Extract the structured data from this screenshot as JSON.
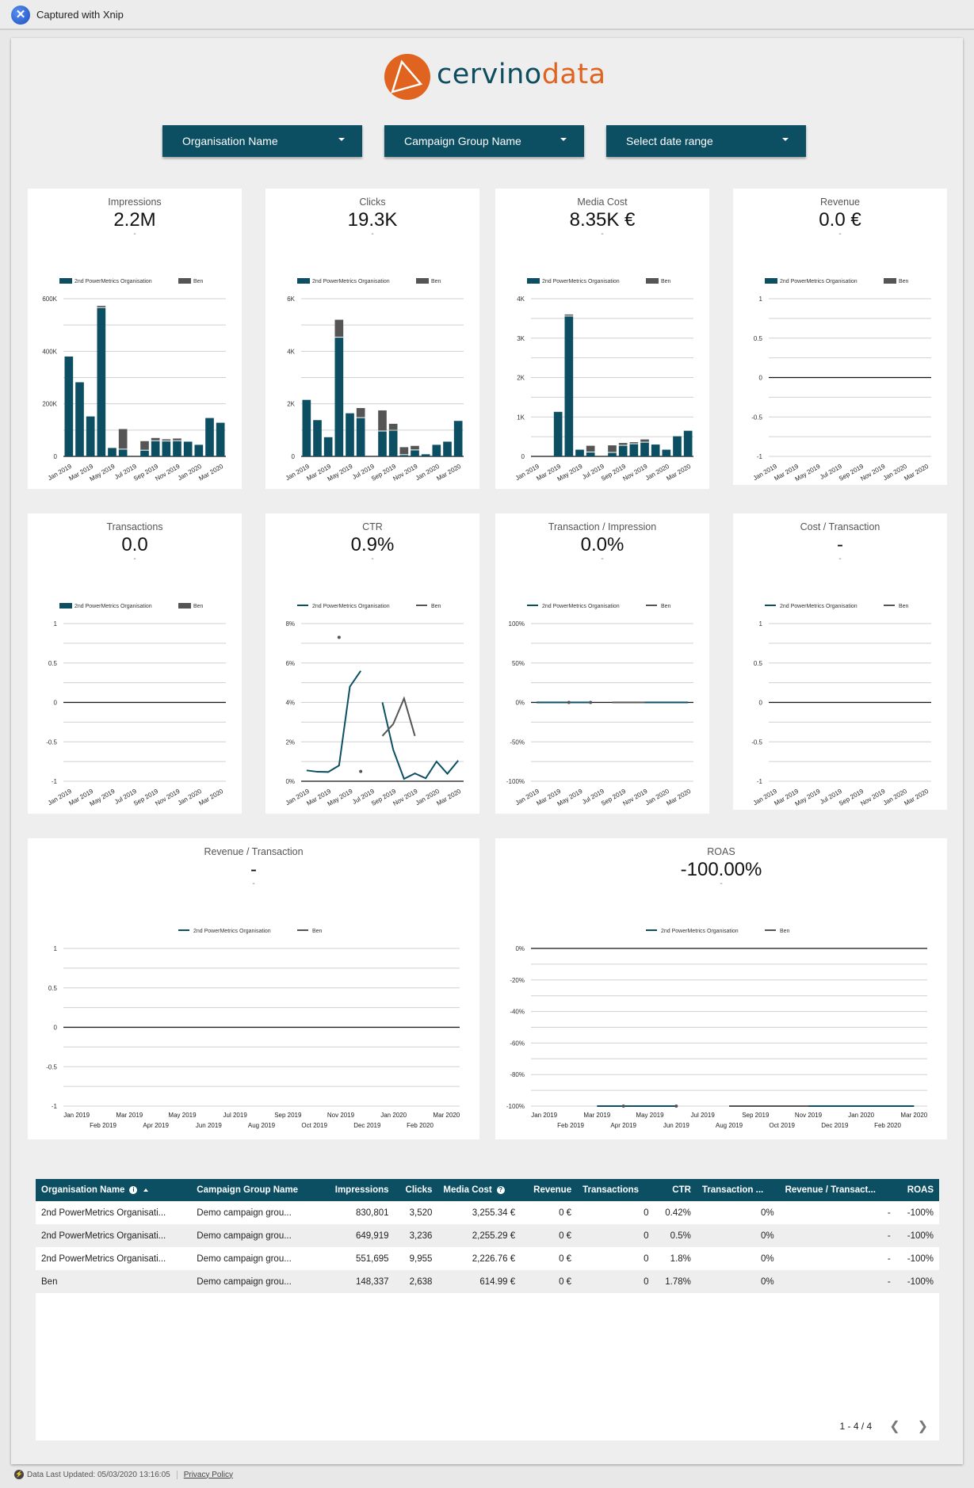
{
  "window": {
    "title": "Captured with Xnip",
    "app_icon": "xnip-icon"
  },
  "brand": {
    "logo_part1": "cervino",
    "logo_part2": "data",
    "primary_color": "#0c4f63",
    "accent_color": "#e0641f"
  },
  "filters": [
    {
      "label": "Organisation Name",
      "icon": "caret-down-icon"
    },
    {
      "label": "Campaign Group Name",
      "icon": "caret-down-icon"
    },
    {
      "label": "Select date range",
      "icon": "caret-down-icon"
    }
  ],
  "legend": {
    "series1": "2nd PowerMetrics Organisation",
    "series2": "Ben",
    "series1_color": "#0c4f63",
    "series2_color": "#555555"
  },
  "scorecards": {
    "impressions": {
      "title": "Impressions",
      "value": "2.2M",
      "delta": "-"
    },
    "clicks": {
      "title": "Clicks",
      "value": "19.3K",
      "delta": "-"
    },
    "media_cost": {
      "title": "Media Cost",
      "value": "8.35K €",
      "delta": "-"
    },
    "revenue": {
      "title": "Revenue",
      "value": "0.0 €",
      "delta": "-"
    },
    "transactions": {
      "title": "Transactions",
      "value": "0.0",
      "delta": "-"
    },
    "ctr": {
      "title": "CTR",
      "value": "0.9%",
      "delta": "-"
    },
    "txn_per_impr": {
      "title": "Transaction / Impression",
      "value": "0.0%",
      "delta": "-"
    },
    "cost_per_txn": {
      "title": "Cost / Transaction",
      "value": "-",
      "delta": "-"
    },
    "rev_per_txn": {
      "title": "Revenue / Transaction",
      "value": "-",
      "delta": "-"
    },
    "roas": {
      "title": "ROAS",
      "value": "-100.00%",
      "delta": "-"
    }
  },
  "chart_data": [
    {
      "id": "impressions",
      "type": "bar",
      "stacked": true,
      "categories": [
        "Jan 2019",
        "Feb 2019",
        "Mar 2019",
        "Apr 2019",
        "May 2019",
        "Jun 2019",
        "Jul 2019",
        "Aug 2019",
        "Sep 2019",
        "Oct 2019",
        "Nov 2019",
        "Dec 2019",
        "Jan 2020",
        "Feb 2020",
        "Mar 2020"
      ],
      "tick_labels": [
        "Jan 2019",
        "Mar 2019",
        "May 2019",
        "Jul 2019",
        "Sep 2019",
        "Nov 2019",
        "Jan 2020",
        "Mar 2020"
      ],
      "series": [
        {
          "name": "2nd PowerMetrics Organisation",
          "values": [
            380000,
            282000,
            152000,
            565000,
            32000,
            26000,
            0,
            22000,
            58000,
            57000,
            58000,
            56000,
            44000,
            146000,
            128000
          ]
        },
        {
          "name": "Ben",
          "values": [
            0,
            0,
            0,
            8000,
            0,
            78000,
            0,
            36000,
            12000,
            8000,
            10000,
            0,
            0,
            0,
            0
          ]
        }
      ],
      "yticks": [
        "0",
        "200K",
        "400K",
        "600K"
      ],
      "ylim": [
        0,
        600000
      ],
      "legend": "top"
    },
    {
      "id": "clicks",
      "type": "bar",
      "stacked": true,
      "categories": [
        "Jan 2019",
        "Feb 2019",
        "Mar 2019",
        "Apr 2019",
        "May 2019",
        "Jun 2019",
        "Jul 2019",
        "Aug 2019",
        "Sep 2019",
        "Oct 2019",
        "Nov 2019",
        "Dec 2019",
        "Jan 2020",
        "Feb 2020",
        "Mar 2020"
      ],
      "tick_labels": [
        "Jan 2019",
        "Mar 2019",
        "May 2019",
        "Jul 2019",
        "Sep 2019",
        "Nov 2019",
        "Jan 2020",
        "Mar 2020"
      ],
      "series": [
        {
          "name": "2nd PowerMetrics Organisation",
          "values": [
            2150,
            1380,
            730,
            4520,
            1640,
            1460,
            0,
            950,
            980,
            50,
            230,
            80,
            440,
            560,
            1350
          ]
        },
        {
          "name": "Ben",
          "values": [
            0,
            0,
            0,
            680,
            0,
            380,
            0,
            800,
            260,
            300,
            170,
            0,
            0,
            0,
            0
          ]
        }
      ],
      "yticks": [
        "0",
        "2K",
        "4K",
        "6K"
      ],
      "ylim": [
        0,
        6000
      ],
      "legend": "top"
    },
    {
      "id": "media_cost",
      "type": "bar",
      "stacked": true,
      "categories": [
        "Jan 2019",
        "Feb 2019",
        "Mar 2019",
        "Apr 2019",
        "May 2019",
        "Jun 2019",
        "Jul 2019",
        "Aug 2019",
        "Sep 2019",
        "Oct 2019",
        "Nov 2019",
        "Dec 2019",
        "Jan 2020",
        "Feb 2020",
        "Mar 2020"
      ],
      "tick_labels": [
        "Jan 2019",
        "Mar 2019",
        "May 2019",
        "Jul 2019",
        "Sep 2019",
        "Nov 2019",
        "Jan 2020",
        "Mar 2020"
      ],
      "series": [
        {
          "name": "2nd PowerMetrics Organisation",
          "values": [
            0,
            0,
            1130,
            3550,
            170,
            100,
            0,
            90,
            270,
            310,
            350,
            300,
            170,
            510,
            650
          ]
        },
        {
          "name": "Ben",
          "values": [
            0,
            0,
            0,
            50,
            0,
            170,
            0,
            190,
            70,
            50,
            80,
            0,
            0,
            0,
            0
          ]
        }
      ],
      "yticks": [
        "0",
        "1K",
        "2K",
        "3K",
        "4K"
      ],
      "ylim": [
        0,
        4000
      ],
      "legend": "top"
    },
    {
      "id": "revenue",
      "type": "bar",
      "stacked": true,
      "tick_labels": [
        "Jan 2019",
        "Mar 2019",
        "May 2019",
        "Jul 2019",
        "Sep 2019",
        "Nov 2019",
        "Jan 2020",
        "Mar 2020"
      ],
      "series": [
        {
          "name": "2nd PowerMetrics Organisation",
          "values": []
        },
        {
          "name": "Ben",
          "values": []
        }
      ],
      "yticks": [
        "-1",
        "-0.5",
        "0",
        "0.5",
        "1"
      ],
      "ylim": [
        -1,
        1
      ],
      "legend": "top"
    },
    {
      "id": "transactions",
      "type": "bar",
      "stacked": true,
      "tick_labels": [
        "Jan 2019",
        "Mar 2019",
        "May 2019",
        "Jul 2019",
        "Sep 2019",
        "Nov 2019",
        "Jan 2020",
        "Mar 2020"
      ],
      "series": [
        {
          "name": "2nd PowerMetrics Organisation",
          "values": []
        },
        {
          "name": "Ben",
          "values": []
        }
      ],
      "yticks": [
        "-1",
        "-0.5",
        "0",
        "0.5",
        "1"
      ],
      "ylim": [
        -1,
        1
      ],
      "legend": "top"
    },
    {
      "id": "ctr",
      "type": "line",
      "categories": [
        "Jan 2019",
        "Feb 2019",
        "Mar 2019",
        "Apr 2019",
        "May 2019",
        "Jun 2019",
        "Jul 2019",
        "Aug 2019",
        "Sep 2019",
        "Oct 2019",
        "Nov 2019",
        "Dec 2019",
        "Jan 2020",
        "Feb 2020",
        "Mar 2020"
      ],
      "tick_labels": [
        "Jan 2019",
        "Mar 2019",
        "May 2019",
        "Jul 2019",
        "Sep 2019",
        "Nov 2019",
        "Jan 2020",
        "Mar 2020"
      ],
      "series": [
        {
          "name": "2nd PowerMetrics Organisation",
          "values": [
            0.55,
            0.48,
            0.47,
            0.8,
            4.8,
            5.6,
            null,
            4.0,
            1.6,
            0.12,
            0.4,
            0.15,
            1.0,
            0.38,
            1.05
          ]
        },
        {
          "name": "Ben",
          "values": [
            null,
            null,
            null,
            7.3,
            null,
            0.5,
            null,
            2.3,
            2.9,
            4.2,
            2.3,
            null,
            null,
            null,
            null
          ]
        }
      ],
      "yticks": [
        "0%",
        "2%",
        "4%",
        "6%",
        "8%"
      ],
      "ylim": [
        0,
        8
      ],
      "legend": "top"
    },
    {
      "id": "txn_per_impr",
      "type": "line",
      "tick_labels": [
        "Jan 2019",
        "Mar 2019",
        "May 2019",
        "Jul 2019",
        "Sep 2019",
        "Nov 2019",
        "Jan 2020",
        "Mar 2020"
      ],
      "series": [
        {
          "name": "2nd PowerMetrics Organisation",
          "values": [
            0,
            0,
            0,
            0,
            0,
            0,
            null,
            0,
            0,
            0,
            0,
            0,
            0,
            0,
            0
          ]
        },
        {
          "name": "Ben",
          "values": [
            null,
            null,
            null,
            0,
            null,
            0,
            null,
            0,
            0,
            0,
            0,
            null,
            null,
            null,
            null
          ]
        }
      ],
      "yticks": [
        "-100%",
        "-50%",
        "0%",
        "50%",
        "100%"
      ],
      "ylim": [
        -100,
        100
      ],
      "legend": "top"
    },
    {
      "id": "cost_per_txn",
      "type": "line",
      "tick_labels": [
        "Jan 2019",
        "Mar 2019",
        "May 2019",
        "Jul 2019",
        "Sep 2019",
        "Nov 2019",
        "Jan 2020",
        "Mar 2020"
      ],
      "series": [
        {
          "name": "2nd PowerMetrics Organisation",
          "values": []
        },
        {
          "name": "Ben",
          "values": []
        }
      ],
      "yticks": [
        "-1",
        "-0.5",
        "0",
        "0.5",
        "1"
      ],
      "ylim": [
        -1,
        1
      ],
      "legend": "top"
    },
    {
      "id": "rev_per_txn",
      "type": "line",
      "tick_labels_row1": [
        "Jan 2019",
        "Mar 2019",
        "May 2019",
        "Jul 2019",
        "Sep 2019",
        "Nov 2019",
        "Jan 2020",
        "Mar 2020"
      ],
      "tick_labels_row2": [
        "Feb 2019",
        "Apr 2019",
        "Jun 2019",
        "Aug 2019",
        "Oct 2019",
        "Dec 2019",
        "Feb 2020"
      ],
      "series": [
        {
          "name": "2nd PowerMetrics Organisation",
          "values": []
        },
        {
          "name": "Ben",
          "values": []
        }
      ],
      "yticks": [
        "-1",
        "-0.5",
        "0",
        "0.5",
        "1"
      ],
      "ylim": [
        -1,
        1
      ],
      "legend": "top"
    },
    {
      "id": "roas",
      "type": "line",
      "categories": [
        "Jan 2019",
        "Feb 2019",
        "Mar 2019",
        "Apr 2019",
        "May 2019",
        "Jun 2019",
        "Jul 2019",
        "Aug 2019",
        "Sep 2019",
        "Oct 2019",
        "Nov 2019",
        "Dec 2019",
        "Jan 2020",
        "Feb 2020",
        "Mar 2020"
      ],
      "tick_labels_row1": [
        "Jan 2019",
        "Mar 2019",
        "May 2019",
        "Jul 2019",
        "Sep 2019",
        "Nov 2019",
        "Jan 2020",
        "Mar 2020"
      ],
      "tick_labels_row2": [
        "Feb 2019",
        "Apr 2019",
        "Jun 2019",
        "Aug 2019",
        "Oct 2019",
        "Dec 2019",
        "Feb 2020"
      ],
      "series": [
        {
          "name": "2nd PowerMetrics Organisation",
          "values": [
            null,
            null,
            -100,
            -100,
            -100,
            -100,
            null,
            null,
            null,
            null,
            -100,
            -100,
            -100,
            -100,
            -100
          ]
        },
        {
          "name": "Ben",
          "values": [
            null,
            null,
            null,
            -100,
            null,
            -100,
            null,
            -100,
            -100,
            -100,
            -100,
            null,
            null,
            null,
            null
          ]
        }
      ],
      "yticks": [
        "-100%",
        "-80%",
        "-60%",
        "-40%",
        "-20%",
        "0%"
      ],
      "ylim": [
        -100,
        0
      ],
      "legend": "top"
    }
  ],
  "table": {
    "columns": [
      {
        "label": "Organisation Name",
        "align": "l",
        "info": true,
        "sort": "asc"
      },
      {
        "label": "Campaign Group Name",
        "align": "l"
      },
      {
        "label": "Impressions",
        "align": "r"
      },
      {
        "label": "Clicks",
        "align": "r"
      },
      {
        "label": "Media Cost",
        "align": "l",
        "info": true
      },
      {
        "label": "Revenue",
        "align": "r"
      },
      {
        "label": "Transactions",
        "align": "l"
      },
      {
        "label": "CTR",
        "align": "r"
      },
      {
        "label": "Transaction ...",
        "align": "l"
      },
      {
        "label": "Revenue / Transact...",
        "align": "l"
      },
      {
        "label": "ROAS",
        "align": "r"
      }
    ],
    "rows": [
      [
        "2nd PowerMetrics Organisati...",
        "Demo campaign grou...",
        "830,801",
        "3,520",
        "3,255.34 €",
        "0 €",
        "0",
        "0.42%",
        "0%",
        "-",
        "-100%"
      ],
      [
        "2nd PowerMetrics Organisati...",
        "Demo campaign grou...",
        "649,919",
        "3,236",
        "2,255.29 €",
        "0 €",
        "0",
        "0.5%",
        "0%",
        "-",
        "-100%"
      ],
      [
        "2nd PowerMetrics Organisati...",
        "Demo campaign grou...",
        "551,695",
        "9,955",
        "2,226.76 €",
        "0 €",
        "0",
        "1.8%",
        "0%",
        "-",
        "-100%"
      ],
      [
        "Ben",
        "Demo campaign grou...",
        "148,337",
        "2,638",
        "614.99 €",
        "0 €",
        "0",
        "1.78%",
        "0%",
        "-",
        "-100%"
      ]
    ],
    "pagination": "1 - 4 / 4"
  },
  "footer": {
    "updated": "Data Last Updated: 05/03/2020 13:16:05",
    "privacy": "Privacy Policy"
  }
}
